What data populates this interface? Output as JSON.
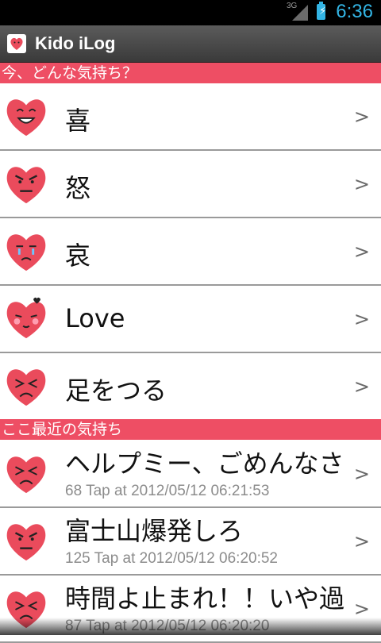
{
  "status": {
    "network": "3G",
    "time": "6:36"
  },
  "app": {
    "title": "Kido iLog"
  },
  "sections": {
    "mood_prompt": "今、どんな気持ち？",
    "recent": "ここ最近の気持ち"
  },
  "moods": [
    {
      "label": "喜",
      "icon": "happy-face-icon"
    },
    {
      "label": "怒",
      "icon": "angry-face-icon"
    },
    {
      "label": "哀",
      "icon": "sad-face-icon"
    },
    {
      "label": "Love",
      "icon": "love-face-icon"
    },
    {
      "label": "足をつる",
      "icon": "cramp-face-icon"
    }
  ],
  "recent": [
    {
      "text": "ヘルプミー、ごめんなさ",
      "meta": "68 Tap at 2012/05/12 06:21:53",
      "icon": "cramp-face-icon"
    },
    {
      "text": "富士山爆発しろ",
      "meta": "125 Tap at 2012/05/12 06:20:52",
      "icon": "angry-face-icon"
    },
    {
      "text": "時間よ止まれ！！いや過",
      "meta": "87 Tap at 2012/05/12 06:20:20",
      "icon": "cramp-face-icon"
    }
  ],
  "chevron": ">",
  "colors": {
    "accent": "#ee4e64",
    "heart": "#ea4b5c",
    "status_blue": "#33b5e5"
  }
}
